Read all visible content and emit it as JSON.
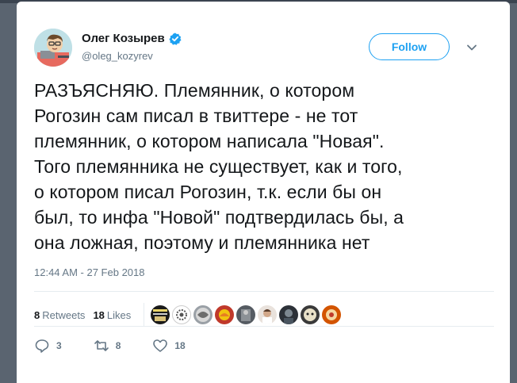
{
  "user": {
    "name": "Олег Козырев",
    "handle": "@oleg_kozyrev",
    "verified": true,
    "avatar_icon": "cartoon-avatar"
  },
  "follow_label": "Follow",
  "tweet": {
    "lines": [
      "РАЗЪЯСНЯЮ. Племянник, о котором",
      "Рогозин сам писал в твиттере - не тот",
      "племянник, о котором написала \"Новая\".",
      "Того племянника не существует, как и того,",
      "о котором писал Рогозин, т.к. если бы он",
      "был, то инфа \"Новой\" подтвердилась бы, а",
      "она ложная, поэтому и племянника нет"
    ],
    "timestamp": "12:44 AM - 27 Feb 2018"
  },
  "stats": {
    "retweets_count": "8",
    "retweets_label": "Retweets",
    "likes_count": "18",
    "likes_label": "Likes"
  },
  "actions": {
    "reply_count": "3",
    "retweet_count": "8",
    "like_count": "18"
  },
  "colors": {
    "accent": "#1da1f2",
    "text": "#14171a",
    "muted": "#657786",
    "border": "#e6ecf0",
    "verified": "#1da1f2"
  }
}
